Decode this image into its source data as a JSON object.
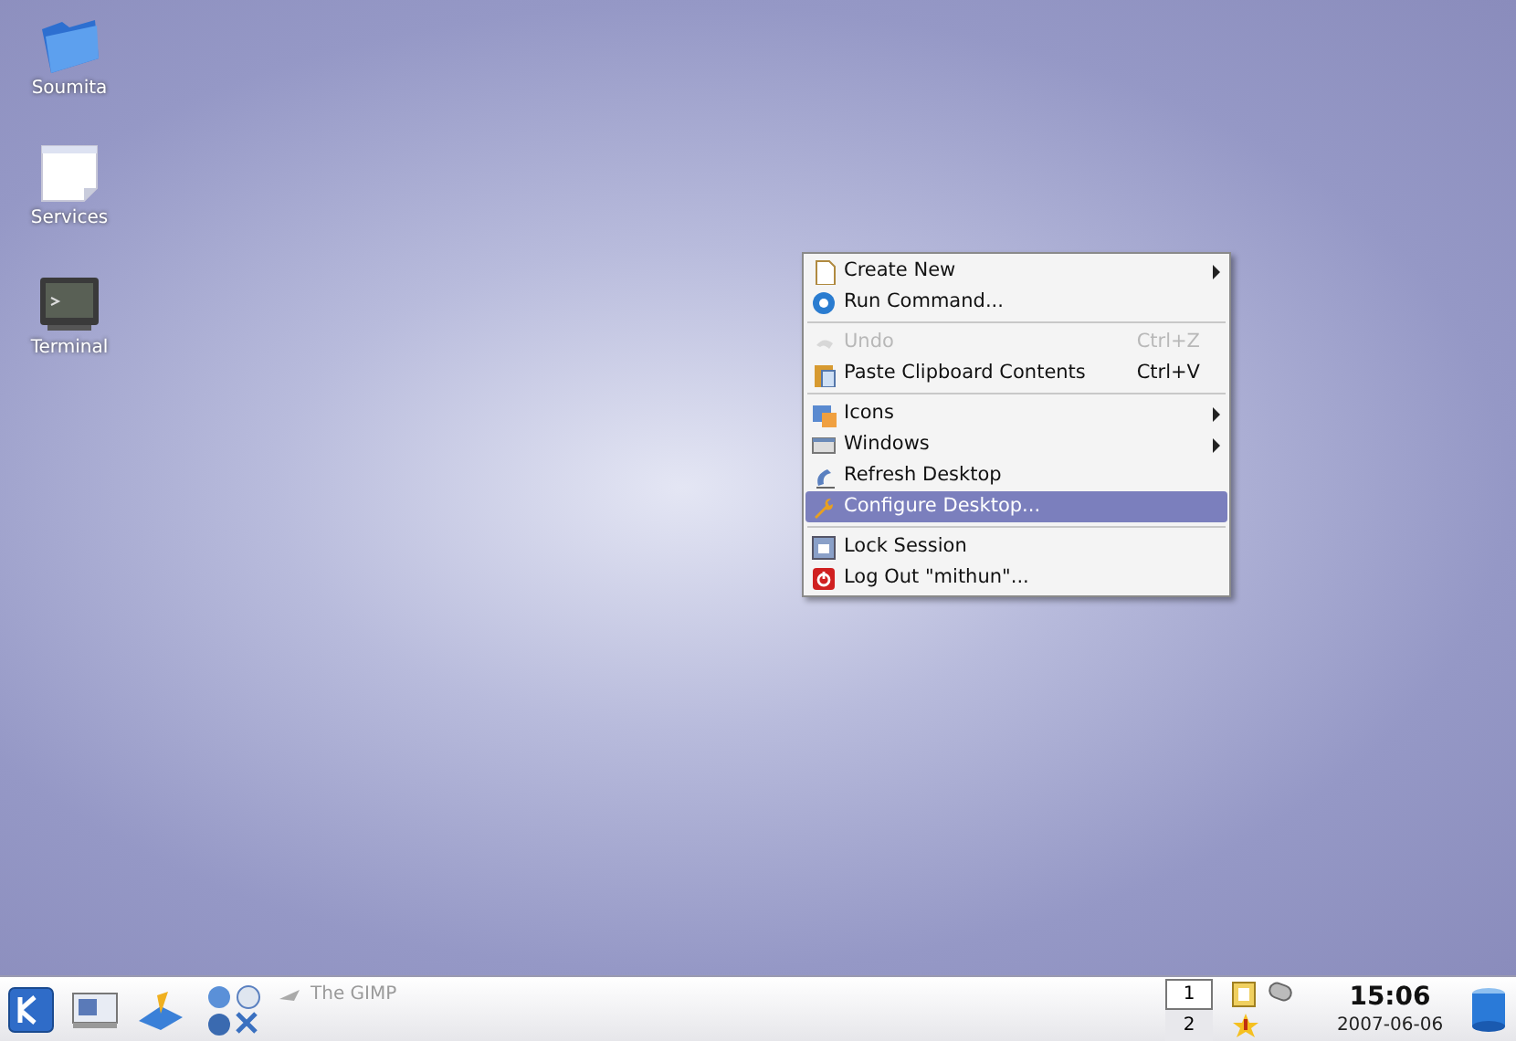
{
  "desktop_icons": [
    {
      "label": "Soumita",
      "kind": "folder"
    },
    {
      "label": "Services",
      "kind": "document"
    },
    {
      "label": "Terminal",
      "kind": "terminal"
    }
  ],
  "context_menu": {
    "items": [
      {
        "kind": "item",
        "label": "Create New",
        "submenu": true,
        "disabled": false,
        "selected": false
      },
      {
        "kind": "item",
        "label": "Run Command...",
        "submenu": false,
        "disabled": false,
        "selected": false
      },
      {
        "kind": "separator"
      },
      {
        "kind": "item",
        "label": "Undo",
        "shortcut": "Ctrl+Z",
        "submenu": false,
        "disabled": true,
        "selected": false
      },
      {
        "kind": "item",
        "label": "Paste Clipboard Contents",
        "shortcut": "Ctrl+V",
        "submenu": false,
        "disabled": false,
        "selected": false
      },
      {
        "kind": "separator"
      },
      {
        "kind": "item",
        "label": "Icons",
        "submenu": true,
        "disabled": false,
        "selected": false
      },
      {
        "kind": "item",
        "label": "Windows",
        "submenu": true,
        "disabled": false,
        "selected": false
      },
      {
        "kind": "item",
        "label": "Refresh Desktop",
        "submenu": false,
        "disabled": false,
        "selected": false
      },
      {
        "kind": "item",
        "label": "Configure Desktop...",
        "submenu": false,
        "disabled": false,
        "selected": true
      },
      {
        "kind": "separator"
      },
      {
        "kind": "item",
        "label": "Lock Session",
        "submenu": false,
        "disabled": false,
        "selected": false
      },
      {
        "kind": "item",
        "label": "Log Out \"mithun\"...",
        "submenu": false,
        "disabled": false,
        "selected": false
      }
    ]
  },
  "taskbar": {
    "task": {
      "label": "The GIMP"
    },
    "pager": [
      {
        "label": "1",
        "selected": true
      },
      {
        "label": "2",
        "selected": false
      }
    ],
    "clock": {
      "time": "15:06",
      "date": "2007-06-06"
    }
  }
}
